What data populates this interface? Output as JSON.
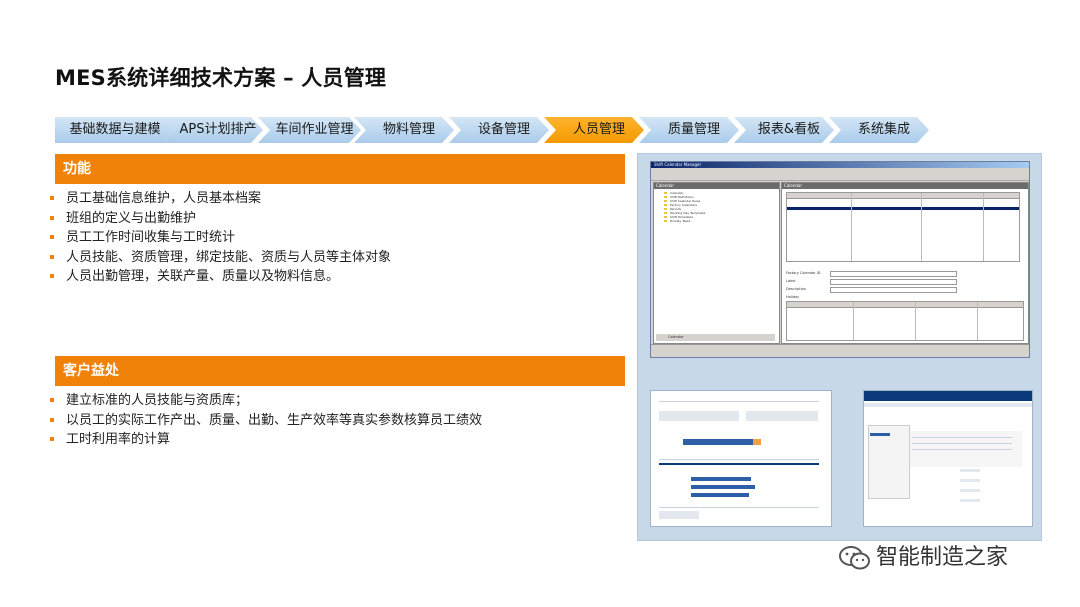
{
  "page": {
    "title": "MES系统详细技术方案 – 人员管理"
  },
  "nav": {
    "items": [
      {
        "label": "基础数据与建模",
        "active": false
      },
      {
        "label": "APS计划排产",
        "active": false
      },
      {
        "label": "车间作业管理",
        "active": false
      },
      {
        "label": "物料管理",
        "active": false
      },
      {
        "label": "设备管理",
        "active": false
      },
      {
        "label": "人员管理",
        "active": true
      },
      {
        "label": "质量管理",
        "active": false
      },
      {
        "label": "报表&看板",
        "active": false
      },
      {
        "label": "系统集成",
        "active": false
      }
    ]
  },
  "features": {
    "heading": "功能",
    "items": [
      "员工基础信息维护，人员基本档案",
      "班组的定义与出勤维护",
      "员工工作时间收集与工时统计",
      "人员技能、资质管理，绑定技能、资质与人员等主体对象",
      "人员出勤管理，关联产量、质量以及物料信息。"
    ]
  },
  "benefits": {
    "heading": "客户益处",
    "items": [
      "建立标准的人员技能与资质库；",
      "以员工的实际工作产出、质量、出勤、生产效率等真实参数核算员工绩效",
      "工时利用率的计算"
    ]
  },
  "screenshot": {
    "window_title": "Shift Calendar Manager",
    "left_pane_header": "Calendar",
    "right_pane_header": "Calendar",
    "tree_items": [
      "Calendar",
      "Shift Definitions",
      "Shift Calendar Rules",
      "Factory Calendars",
      "Periods",
      "Working Day Templates",
      "Shift Templates",
      "Holiday Tasks"
    ],
    "field_labels": [
      "Factory Calendar ID",
      "Label",
      "Description"
    ],
    "holiday_label": "Holiday",
    "left_footer": "Calendar"
  },
  "watermark": {
    "text": "智能制造之家"
  },
  "colors": {
    "accent": "#f0820a",
    "nav": "#b8d4ee",
    "nav_active": "#f5a000"
  }
}
